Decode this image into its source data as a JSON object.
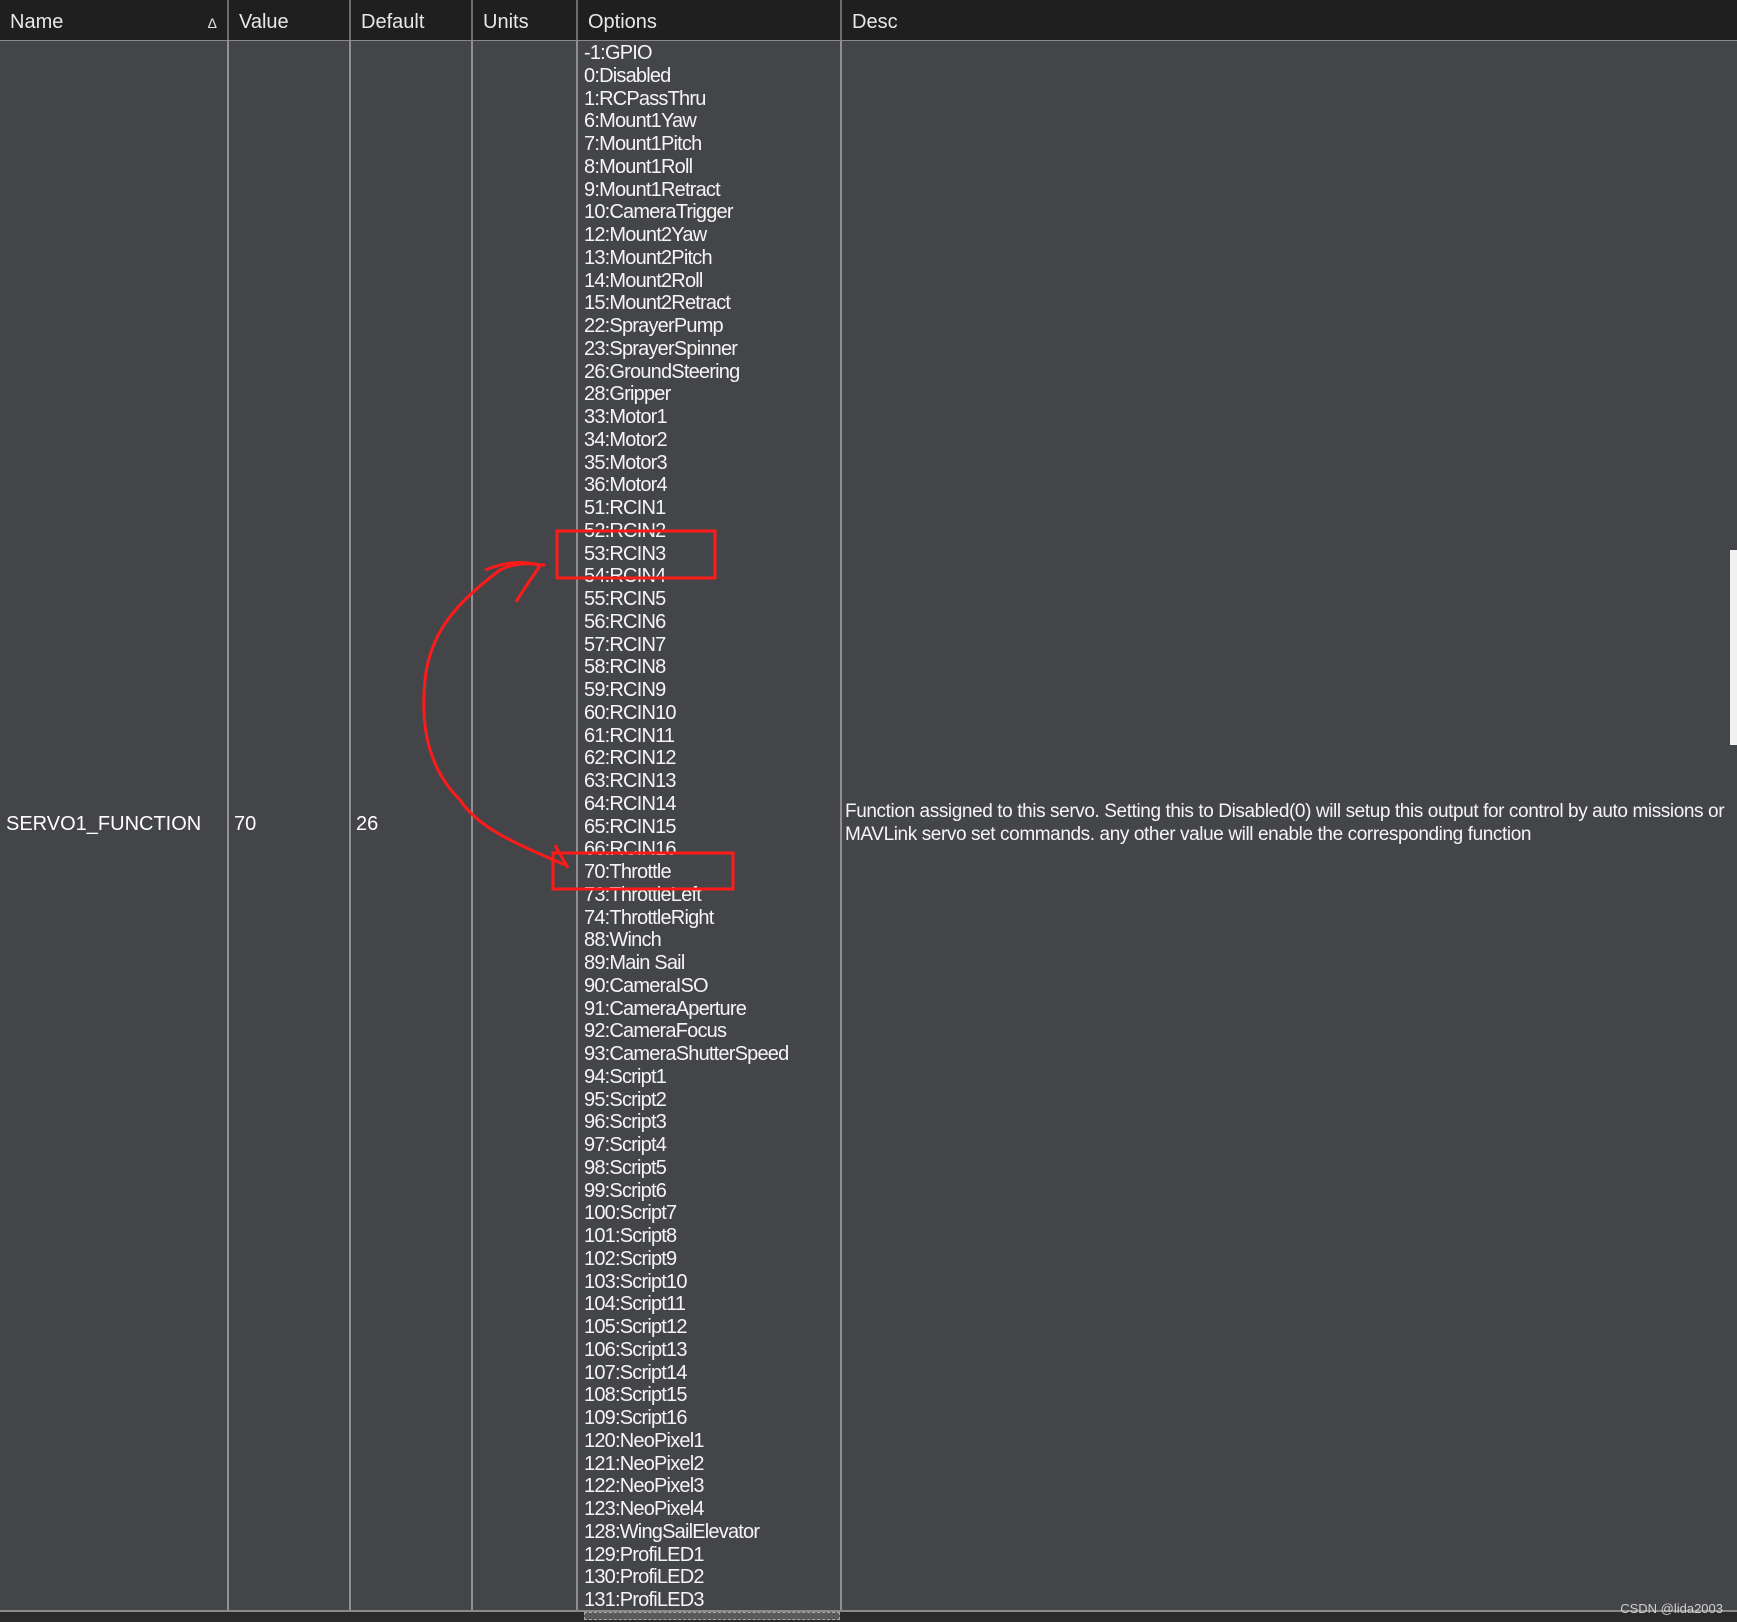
{
  "columns": {
    "name": "Name",
    "value": "Value",
    "default": "Default",
    "units": "Units",
    "options": "Options",
    "desc": "Desc"
  },
  "sort_indicator": "Δ",
  "row": {
    "name": "SERVO1_FUNCTION",
    "value": "70",
    "default": "26",
    "units": "",
    "desc": "Function assigned to this servo. Setting this to Disabled(0) will setup this output for control by auto missions or MAVLink servo set commands. any other value will enable the corresponding function"
  },
  "options": [
    "-1:GPIO",
    "0:Disabled",
    "1:RCPassThru",
    "6:Mount1Yaw",
    "7:Mount1Pitch",
    "8:Mount1Roll",
    "9:Mount1Retract",
    "10:CameraTrigger",
    "12:Mount2Yaw",
    "13:Mount2Pitch",
    "14:Mount2Roll",
    "15:Mount2Retract",
    "22:SprayerPump",
    "23:SprayerSpinner",
    "26:GroundSteering",
    "28:Gripper",
    "33:Motor1",
    "34:Motor2",
    "35:Motor3",
    "36:Motor4",
    "51:RCIN1",
    "52:RCIN2",
    "53:RCIN3",
    "54:RCIN4",
    "55:RCIN5",
    "56:RCIN6",
    "57:RCIN7",
    "58:RCIN8",
    "59:RCIN9",
    "60:RCIN10",
    "61:RCIN11",
    "62:RCIN12",
    "63:RCIN13",
    "64:RCIN14",
    "65:RCIN15",
    "66:RCIN16",
    "70:Throttle",
    "73:ThrottleLeft",
    "74:ThrottleRight",
    "88:Winch",
    "89:Main Sail",
    "90:CameraISO",
    "91:CameraAperture",
    "92:CameraFocus",
    "93:CameraShutterSpeed",
    "94:Script1",
    "95:Script2",
    "96:Script3",
    "97:Script4",
    "98:Script5",
    "99:Script6",
    "100:Script7",
    "101:Script8",
    "102:Script9",
    "103:Script10",
    "104:Script11",
    "105:Script12",
    "106:Script13",
    "107:Script14",
    "108:Script15",
    "109:Script16",
    "120:NeoPixel1",
    "121:NeoPixel2",
    "122:NeoPixel3",
    "123:NeoPixel4",
    "128:WingSailElevator",
    "129:ProfiLED1",
    "130:ProfiLED2",
    "131:ProfiLED3"
  ],
  "annotation_color": "#ff1a1a",
  "watermark": "CSDN @lida2003"
}
